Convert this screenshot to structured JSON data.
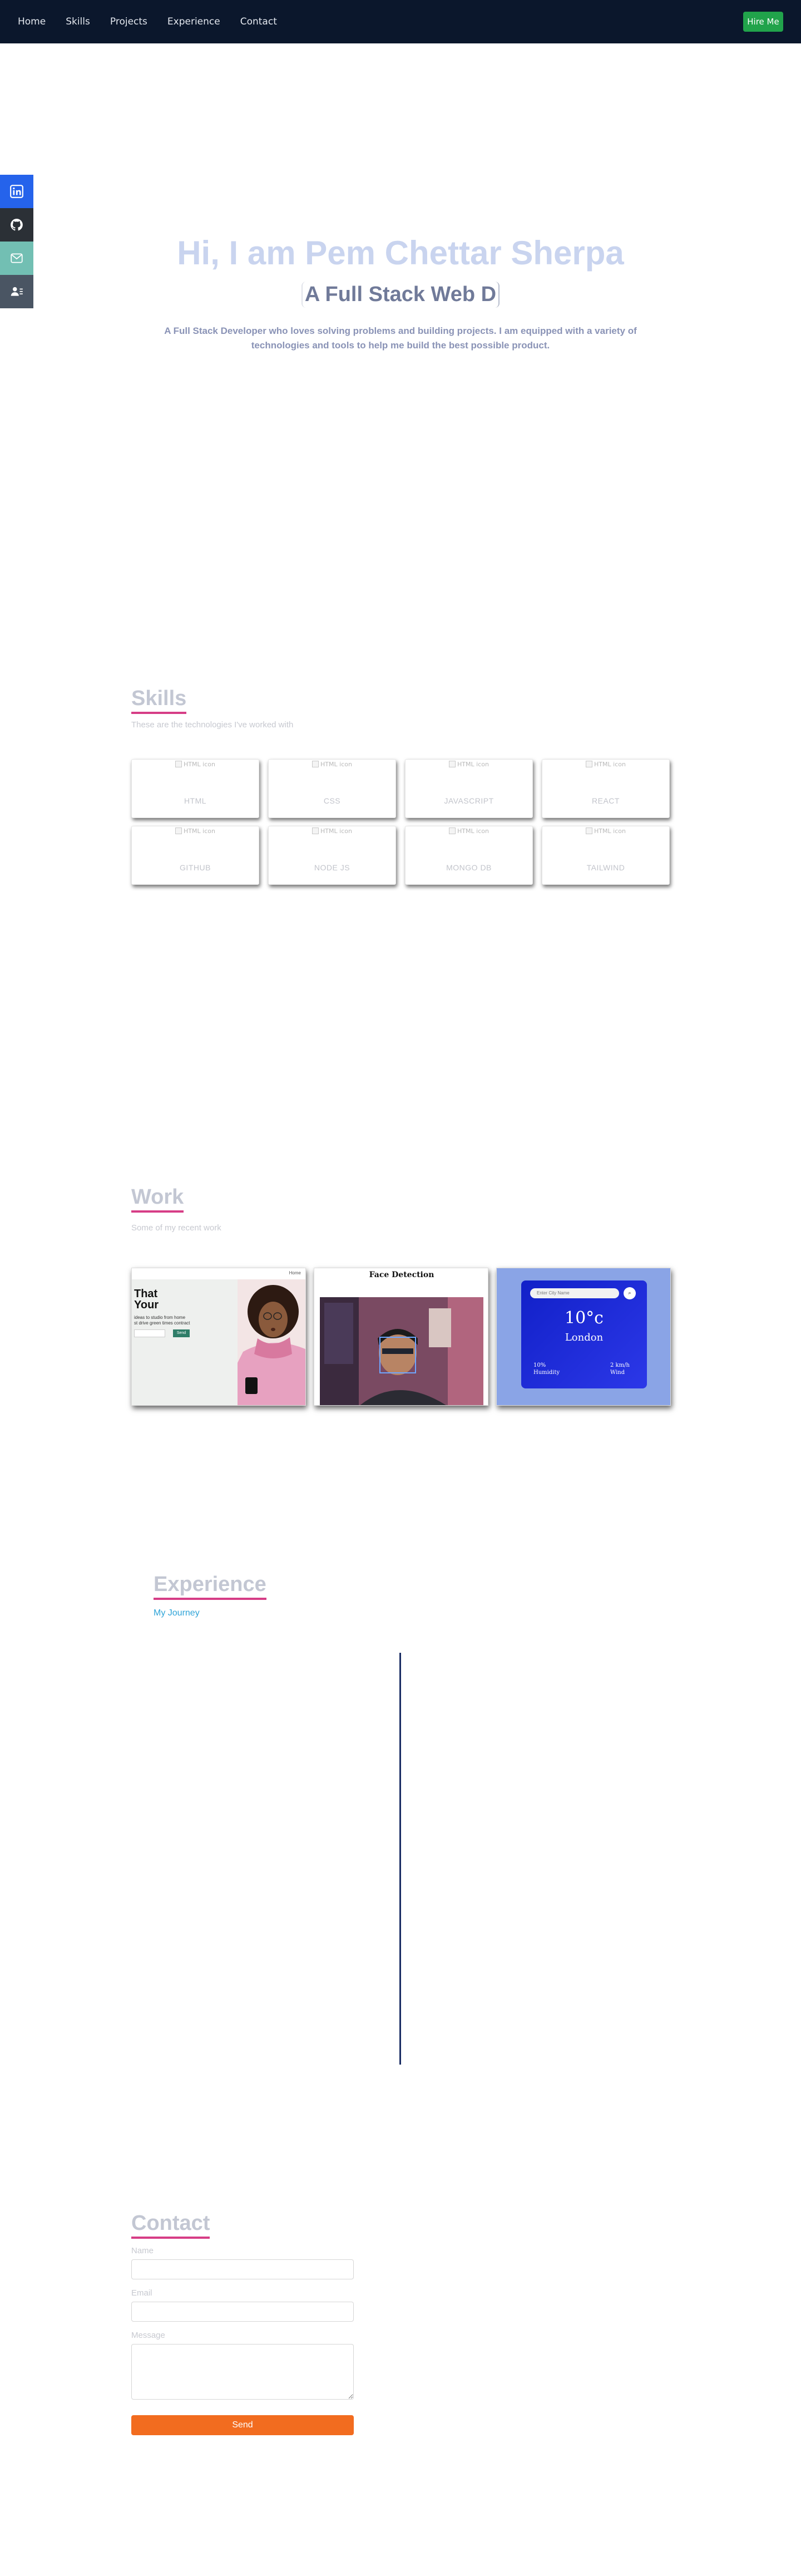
{
  "nav": {
    "links": [
      "Home",
      "Skills",
      "Projects",
      "Experience",
      "Contact"
    ],
    "hire_label": "Hire Me"
  },
  "social": {
    "items": [
      {
        "icon": "linkedin-icon",
        "color": "#2563eb"
      },
      {
        "icon": "github-icon",
        "color": "#2b3036"
      },
      {
        "icon": "mail-icon",
        "color": "#72bfb3"
      },
      {
        "icon": "resume-icon",
        "color": "#4a5563"
      }
    ]
  },
  "hero": {
    "title": "Hi, I am Pem Chettar Sherpa",
    "subtitle": "A Full Stack Web D",
    "description": "A Full Stack Developer who loves solving problems and building projects. I am equipped with a variety of technologies and tools to help me build the best possible product."
  },
  "skills": {
    "title": "Skills",
    "subtitle": "These are the technologies I've worked with",
    "img_alt": "HTML icon",
    "items": [
      "HTML",
      "CSS",
      "JAVASCRIPT",
      "REACT",
      "GITHUB",
      "NODE JS",
      "MONGO DB",
      "TAILWIND"
    ]
  },
  "work": {
    "title": "Work",
    "subtitle": "Some of my recent work",
    "projects": [
      {
        "headline_1": "That",
        "headline_2": "Your",
        "body_1": "ideas to studio from home",
        "body_2": "st drive green times contract",
        "button": "Send",
        "nav_label": "Home"
      },
      {
        "title": "Face Detection"
      },
      {
        "placeholder": "Enter City Name",
        "temp": "10°c",
        "city": "London",
        "humidity_value": "10%",
        "humidity_label": "Humidity",
        "wind_value": "2 km/h",
        "wind_label": "Wind"
      }
    ]
  },
  "experience": {
    "title": "Experience",
    "subtitle": "My Journey"
  },
  "contact": {
    "title": "Contact",
    "name_label": "Name",
    "email_label": "Email",
    "message_label": "Message",
    "send_label": "Send"
  },
  "colors": {
    "nav_bg": "#0b172c",
    "hire_btn": "#21a34b",
    "accent_underline": "#d63d86",
    "send_btn": "#f26c1f",
    "timeline": "#1a2d63"
  }
}
